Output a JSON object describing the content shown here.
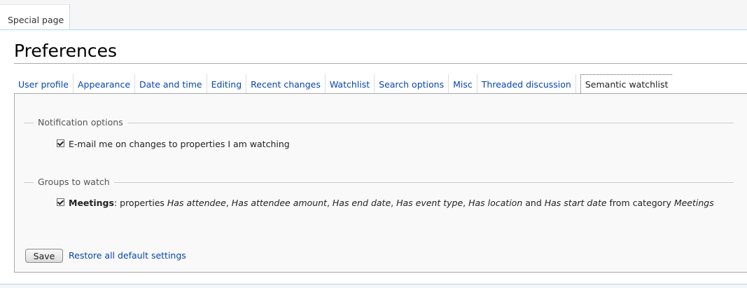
{
  "page_tab": {
    "label": "Special page"
  },
  "page_title": "Preferences",
  "tabs": [
    {
      "label": "User profile"
    },
    {
      "label": "Appearance"
    },
    {
      "label": "Date and time"
    },
    {
      "label": "Editing"
    },
    {
      "label": "Recent changes"
    },
    {
      "label": "Watchlist"
    },
    {
      "label": "Search options"
    },
    {
      "label": "Misc"
    },
    {
      "label": "Threaded discussion"
    },
    {
      "label": "Semantic watchlist",
      "active": true
    }
  ],
  "notification": {
    "legend": "Notification options",
    "option_label": "E-mail me on changes to properties I am watching",
    "checked": true
  },
  "groups": {
    "legend": "Groups to watch",
    "item": {
      "name": "Meetings",
      "sep": ": properties ",
      "p1": "Has attendee",
      "c1": ", ",
      "p2": "Has attendee amount",
      "c2": ", ",
      "p3": "Has end date",
      "c3": ", ",
      "p4": "Has event type",
      "c4": ", ",
      "p5": "Has location",
      "and": " and ",
      "p6": "Has start date",
      "from": " from category ",
      "category": "Meetings",
      "checked": true
    }
  },
  "actions": {
    "save_label": "Save",
    "restore_label": "Restore all default settings"
  },
  "colors": {
    "link": "#0645ad",
    "border_blue": "#a7d7f9"
  }
}
